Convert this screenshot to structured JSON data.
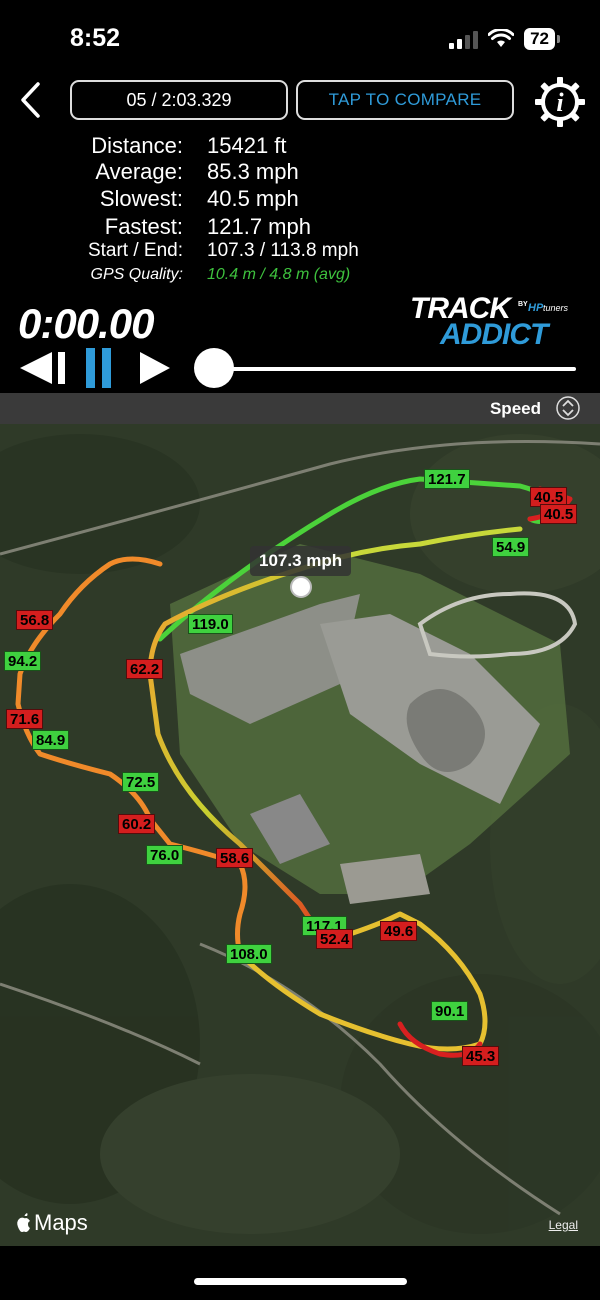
{
  "status_bar": {
    "time": "8:52",
    "battery": "72"
  },
  "header": {
    "lap_label": "05 / 2:03.329",
    "compare_label": "TAP TO COMPARE"
  },
  "stats": [
    {
      "label": "Distance:",
      "value": "15421 ft"
    },
    {
      "label": "Average:",
      "value": "85.3 mph"
    },
    {
      "label": "Slowest:",
      "value": "40.5 mph"
    },
    {
      "label": "Fastest:",
      "value": "121.7 mph"
    },
    {
      "label": "Start / End:",
      "value": "107.3 / 113.8 mph"
    },
    {
      "label": "GPS Quality:",
      "value": "10.4 m / 4.8 m (avg)"
    }
  ],
  "timer": "0:00.00",
  "logo": {
    "line1": "TRACK",
    "by": "BY",
    "brand": "HP",
    "brand_suffix": "tuners",
    "line2": "ADDICT"
  },
  "playback": {
    "progress": 0
  },
  "speed_bar": {
    "label": "Speed"
  },
  "map": {
    "tooltip": "107.3 mph",
    "attribution": "Maps",
    "legal": "Legal",
    "speed_tags": [
      {
        "text": "121.7",
        "color": "green"
      },
      {
        "text": "40.5",
        "color": "red"
      },
      {
        "text": "40.5",
        "color": "red"
      },
      {
        "text": "54.9",
        "color": "green"
      },
      {
        "text": "119.0",
        "color": "green"
      },
      {
        "text": "56.8",
        "color": "red"
      },
      {
        "text": "62.2",
        "color": "red"
      },
      {
        "text": "94.2",
        "color": "green"
      },
      {
        "text": "71.6",
        "color": "red"
      },
      {
        "text": "84.9",
        "color": "green"
      },
      {
        "text": "72.5",
        "color": "green"
      },
      {
        "text": "60.2",
        "color": "red"
      },
      {
        "text": "76.0",
        "color": "green"
      },
      {
        "text": "58.6",
        "color": "red"
      },
      {
        "text": "117.1",
        "color": "green"
      },
      {
        "text": "52.4",
        "color": "red"
      },
      {
        "text": "49.6",
        "color": "red"
      },
      {
        "text": "108.0",
        "color": "green"
      },
      {
        "text": "90.1",
        "color": "green"
      },
      {
        "text": "45.3",
        "color": "red"
      }
    ]
  },
  "colors": {
    "accent_blue": "#2f9bd9",
    "gps_green": "#3ec23e",
    "speed_green": "#3fd13f",
    "speed_red": "#d41e1e"
  }
}
